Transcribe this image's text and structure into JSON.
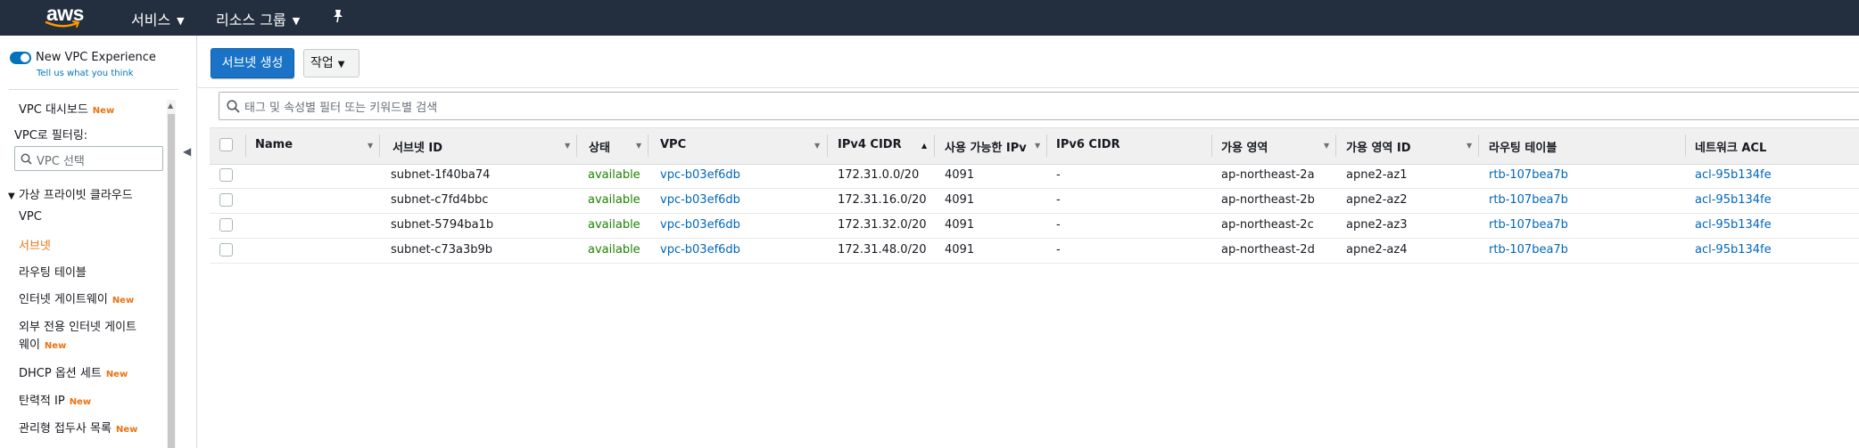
{
  "topnav": {
    "logo_text": "aws",
    "services_label": "서비스",
    "resource_groups_label": "리소스 그룹",
    "pin_icon": "pin-icon"
  },
  "sidebar": {
    "new_experience_label": "New VPC Experience",
    "feedback_link": "Tell us what you think",
    "dashboard_label": "VPC 대시보드",
    "new_badge": "New",
    "filter_label": "VPC로 필터링:",
    "filter_placeholder": "VPC 선택",
    "section_title": "가상 프라이빗 클라우드",
    "items": [
      {
        "label": "VPC",
        "new": ""
      },
      {
        "label": "서브넷",
        "new": ""
      },
      {
        "label": "라우팅 테이블",
        "new": ""
      },
      {
        "label": "인터넷 게이트웨이",
        "new": "New"
      },
      {
        "label": "외부 전용 인터넷 게이트",
        "new": ""
      },
      {
        "label": "웨이",
        "new": "New"
      },
      {
        "label": "DHCP 옵션 세트",
        "new": "New"
      },
      {
        "label": "탄력적 IP",
        "new": "New"
      },
      {
        "label": "관리형 접두사 목록",
        "new": "New"
      }
    ],
    "active_color": "#ec7211"
  },
  "toolbar": {
    "create_subnet_label": "서브넷 생성",
    "actions_label": "작업"
  },
  "filter": {
    "placeholder": "태그 및 속성별 필터 또는 키워드별 검색"
  },
  "table": {
    "columns": [
      "Name",
      "서브넷 ID",
      "상태",
      "VPC",
      "IPv4 CIDR",
      "사용 가능한 IPv",
      "IPv6 CIDR",
      "가용 영역",
      "가용 영역 ID",
      "라우팅 테이블",
      "네트워크 ACL"
    ],
    "rows": [
      {
        "name": "",
        "subnet_id": "subnet-1f40ba74",
        "state": "available",
        "vpc": "vpc-b03ef6db",
        "ipv4": "172.31.0.0/20",
        "available_ips": "4091",
        "ipv6": "-",
        "az": "ap-northeast-2a",
        "az_id": "apne2-az1",
        "route_table": "rtb-107bea7b",
        "acl": "acl-95b134fe"
      },
      {
        "name": "",
        "subnet_id": "subnet-c7fd4bbc",
        "state": "available",
        "vpc": "vpc-b03ef6db",
        "ipv4": "172.31.16.0/20",
        "available_ips": "4091",
        "ipv6": "-",
        "az": "ap-northeast-2b",
        "az_id": "apne2-az2",
        "route_table": "rtb-107bea7b",
        "acl": "acl-95b134fe"
      },
      {
        "name": "",
        "subnet_id": "subnet-5794ba1b",
        "state": "available",
        "vpc": "vpc-b03ef6db",
        "ipv4": "172.31.32.0/20",
        "available_ips": "4091",
        "ipv6": "-",
        "az": "ap-northeast-2c",
        "az_id": "apne2-az3",
        "route_table": "rtb-107bea7b",
        "acl": "acl-95b134fe"
      },
      {
        "name": "",
        "subnet_id": "subnet-c73a3b9b",
        "state": "available",
        "vpc": "vpc-b03ef6db",
        "ipv4": "172.31.48.0/20",
        "available_ips": "4091",
        "ipv6": "-",
        "az": "ap-northeast-2d",
        "az_id": "apne2-az4",
        "route_table": "rtb-107bea7b",
        "acl": "acl-95b134fe"
      }
    ]
  },
  "colors": {
    "nav_bg": "#232f3e",
    "primary": "#1a73c7",
    "link": "#0066bb",
    "available": "#1d8102"
  }
}
